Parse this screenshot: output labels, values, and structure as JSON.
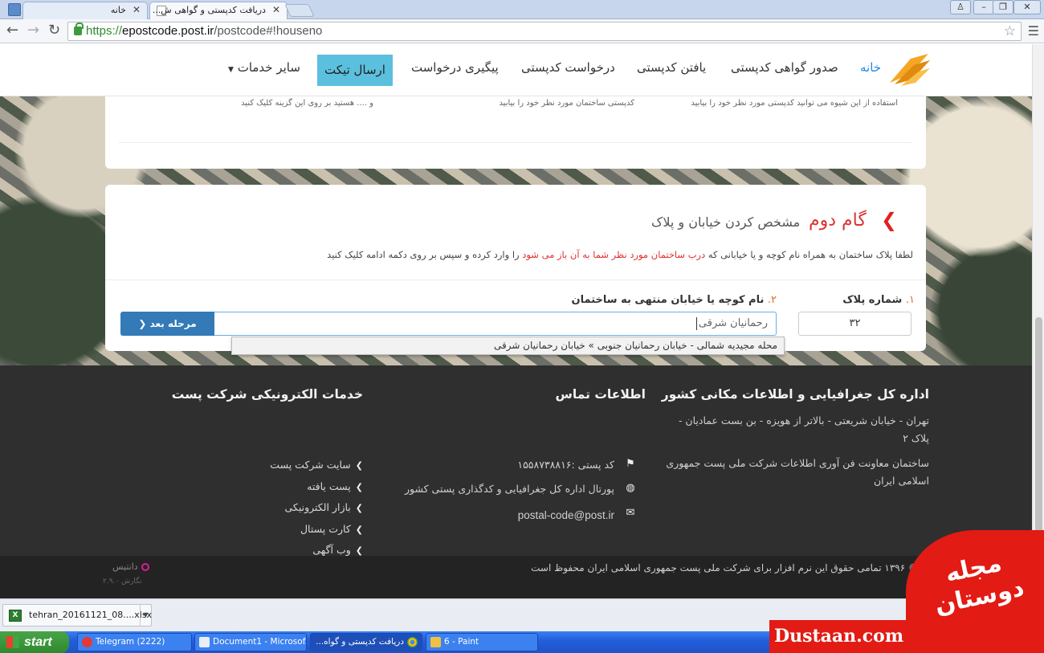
{
  "browser": {
    "tabs": [
      {
        "title": "خانه",
        "active": false
      },
      {
        "title": "دریافت کدپستی و گواهی ش...",
        "active": true
      }
    ],
    "url": {
      "scheme": "https://",
      "host": "epostcode.post.ir",
      "path": "/postcode#!houseno"
    },
    "window_buttons": [
      "user-icon",
      "minimize-icon",
      "restore-icon",
      "close-icon"
    ]
  },
  "site_nav": {
    "home": "خانه",
    "items": [
      "صدور گواهی کدپستی",
      "یافتن کدپستی",
      "درخواست کدپستی",
      "پیگیری درخواست"
    ],
    "ticket": "ارسال تیکت",
    "more": "سایر خدمات"
  },
  "step1_hints": [
    "استفاده از این شیوه می توانید کدپستی مورد نظر خود را بیابید",
    "کدپستی ساختمان مورد نظر خود را بیابید",
    "و .... هستید بر روی این گزینه کلیک کنید"
  ],
  "step2": {
    "title": "گام دوم",
    "subtitle": "مشخص کردن خیابان و پلاک",
    "instruction_pre": "لطفا پلاک ساختمان به همراه نام کوچه و یا خیابانی که ",
    "instruction_highlight": "درب ساختمان مورد نظر شما به آن باز می شود",
    "instruction_post": " را وارد کرده و سپس بر روی دکمه ادامه کلیک کنید",
    "label1_num": "۱.",
    "label1": "شماره پلاک",
    "label2_num": "۲.",
    "label2": "نام کوچه یا خیابان منتهی به ساختمان",
    "plak_value": "۳۲",
    "street_value": "رحمانیان شرقی",
    "next_button": "مرحله بعد",
    "suggestion": "محله مجیدیه شمالی - خیابان رحمانیان جنوبی » خیابان رحمانیان شرقی"
  },
  "footer": {
    "col1": {
      "title": "اداره کل جغرافیایی و اطلاعات مکانی کشور",
      "address": "تهران - خیابان شریعتی - بالاتر از هویزه - بن بست عمادیان - پلاک ۲",
      "building": "ساختمان معاونت فن آوری اطلاعات شرکت ملی پست جمهوری اسلامی ایران"
    },
    "col2": {
      "title": "اطلاعات تماس",
      "postal": "کد پستی :۱۵۵۸۷۳۸۸۱۶",
      "portal": "پورتال اداره کل جغرافیایی و کدگذاری پستی کشور",
      "email": "postal-code@post.ir"
    },
    "col3": {
      "title": "خدمات الکترونیکی شرکت پست",
      "links": [
        "سایت شرکت پست",
        "پست یافته",
        "بازار الکترونیکی",
        "کارت پستال",
        "وب آگهی"
      ]
    },
    "copyright": "© ۱۳۹۶ تمامی حقوق این نرم افزار برای شرکت ملی پست جمهوری اسلامی ایران محفوظ است",
    "dantis": "دانتیس",
    "version": "نگارش ۲.۹.۰"
  },
  "download": {
    "file": "tehran_20161121_08....xlsx"
  },
  "taskbar": {
    "start": "start",
    "items": [
      "Telegram (2222)",
      "Document1 - Microsof...",
      "دریافت کدپستی و گواه...",
      "6 - Paint"
    ]
  },
  "watermark": {
    "logo_text": "مجله دوستان",
    "brand": "Dustaan.com"
  },
  "colors": {
    "accent_blue": "#337ab7",
    "accent_red": "#e02020",
    "ticket_cyan": "#5bc0de",
    "footer_bg": "#2f2f2f"
  }
}
